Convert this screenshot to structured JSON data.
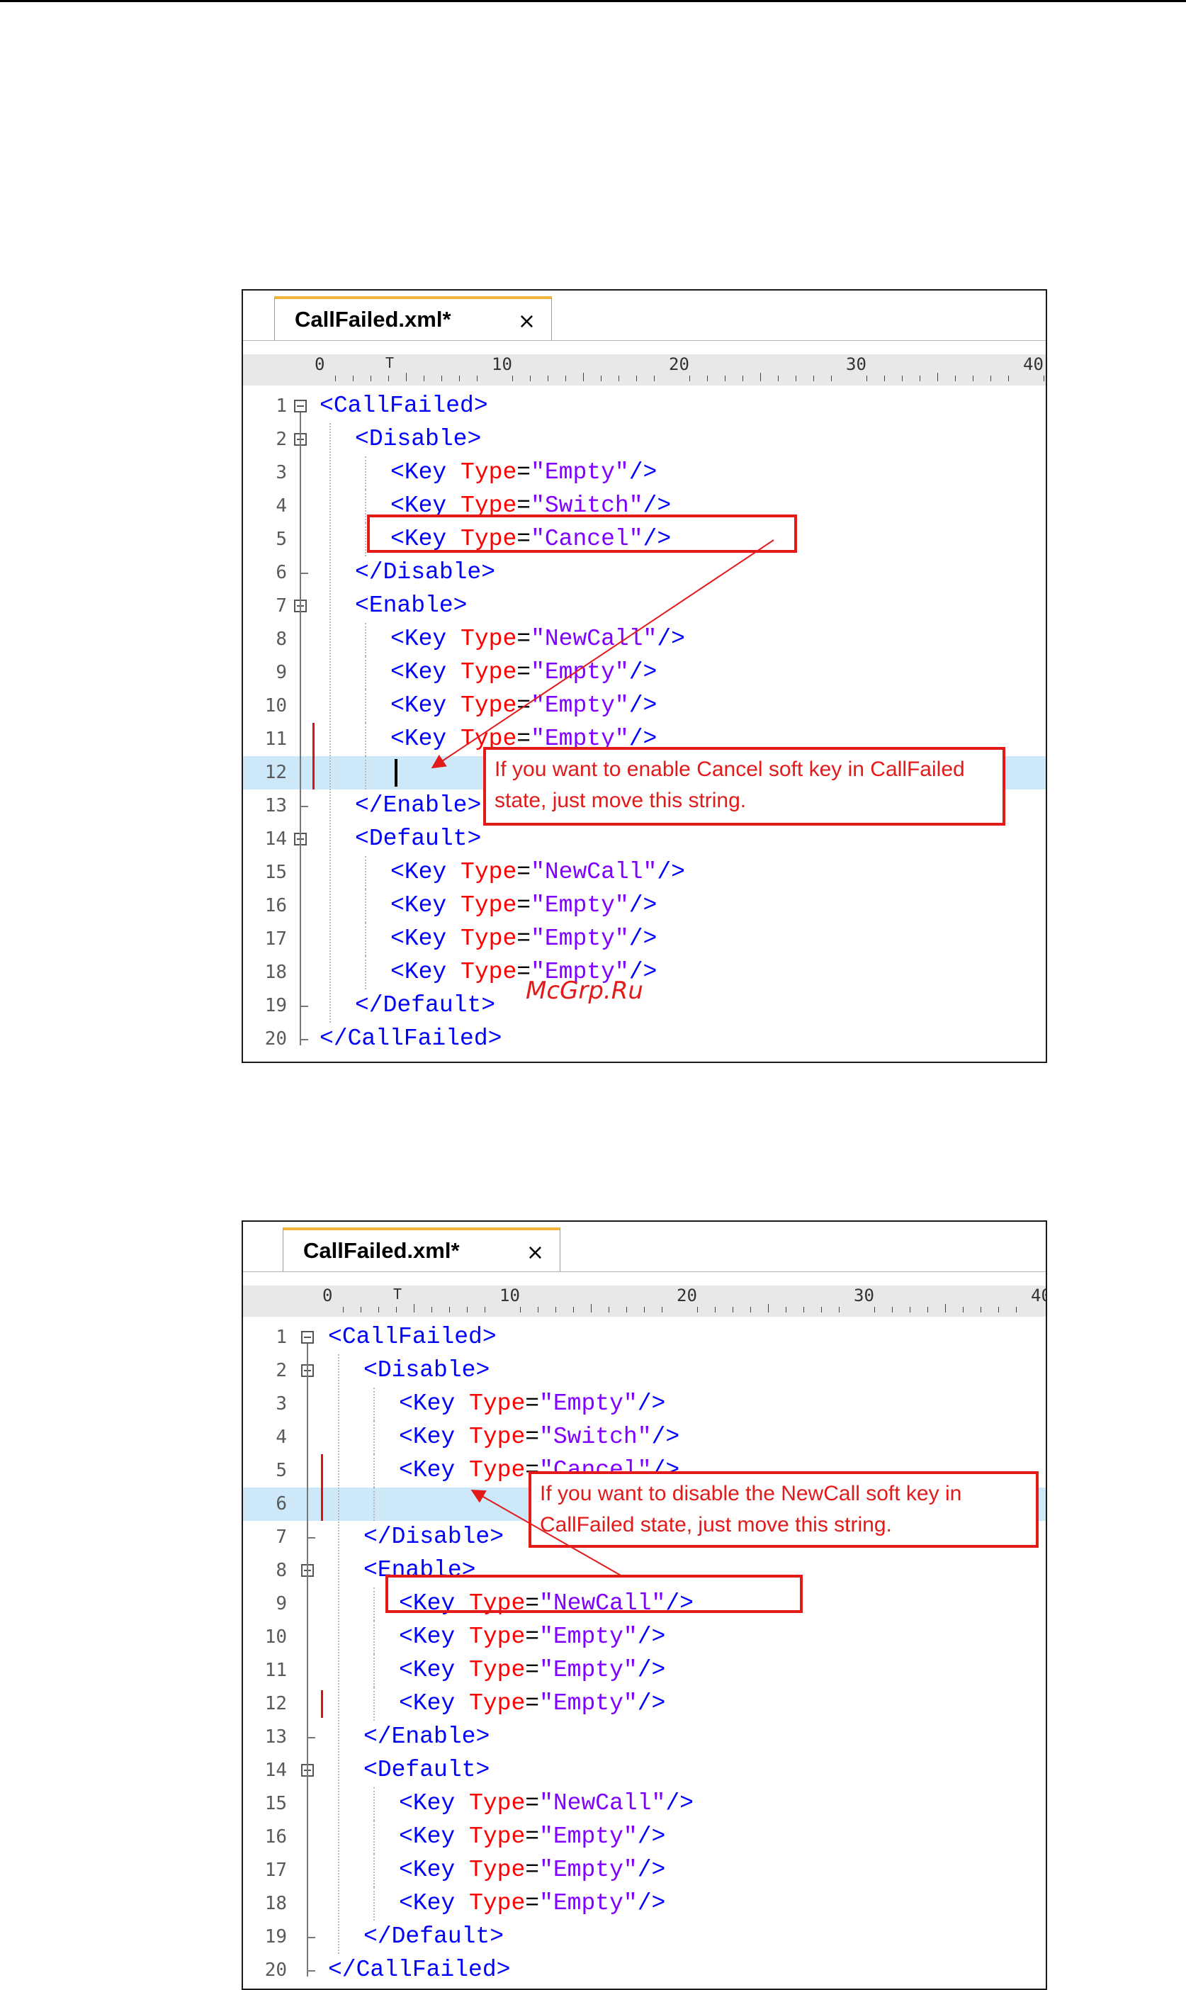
{
  "watermark": "McGrp.Ru",
  "colors": {
    "annotation": "#e21a1a",
    "tag": "#0000ff",
    "attribute": "#ff0000",
    "value": "#8000ff",
    "current_line": "#cde8f8",
    "tab_accent": "#f0b43c"
  },
  "ruler": {
    "labels": [
      "0",
      "10",
      "20",
      "30",
      "40"
    ],
    "marker": "T"
  },
  "editors": [
    {
      "tab": {
        "title": "CallFailed.xml*",
        "close": "×"
      },
      "current_line": 12,
      "callout": "If you want to enable Cancel soft key in CallFailed state, just move this string.",
      "lines": [
        {
          "n": "1",
          "indent": 0,
          "text": "<CallFailed>"
        },
        {
          "n": "2",
          "indent": 1,
          "text": "<Disable>"
        },
        {
          "n": "3",
          "indent": 2,
          "text": "<Key Type=\"Empty\"/>"
        },
        {
          "n": "4",
          "indent": 2,
          "text": "<Key Type=\"Switch\"/>"
        },
        {
          "n": "5",
          "indent": 2,
          "text": "<Key Type=\"Cancel\"/>"
        },
        {
          "n": "6",
          "indent": 1,
          "text": "</Disable>"
        },
        {
          "n": "7",
          "indent": 1,
          "text": "<Enable>"
        },
        {
          "n": "8",
          "indent": 2,
          "text": "<Key Type=\"NewCall\"/>"
        },
        {
          "n": "9",
          "indent": 2,
          "text": "<Key Type=\"Empty\"/>"
        },
        {
          "n": "10",
          "indent": 2,
          "text": "<Key Type=\"Empty\"/>"
        },
        {
          "n": "11",
          "indent": 2,
          "text": "<Key Type=\"Empty\"/>"
        },
        {
          "n": "12",
          "indent": 2,
          "text": ""
        },
        {
          "n": "13",
          "indent": 1,
          "text": "</Enable>"
        },
        {
          "n": "14",
          "indent": 1,
          "text": "<Default>"
        },
        {
          "n": "15",
          "indent": 2,
          "text": "<Key Type=\"NewCall\"/>"
        },
        {
          "n": "16",
          "indent": 2,
          "text": "<Key Type=\"Empty\"/>"
        },
        {
          "n": "17",
          "indent": 2,
          "text": "<Key Type=\"Empty\"/>"
        },
        {
          "n": "18",
          "indent": 2,
          "text": "<Key Type=\"Empty\"/>"
        },
        {
          "n": "19",
          "indent": 1,
          "text": "</Default>"
        },
        {
          "n": "20",
          "indent": 0,
          "text": "</CallFailed>"
        }
      ]
    },
    {
      "tab": {
        "title": "CallFailed.xml*",
        "close": "×"
      },
      "current_line": 6,
      "callout": "If you want to disable the NewCall soft key in CallFailed state, just move this string.",
      "lines": [
        {
          "n": "1",
          "indent": 0,
          "text": "<CallFailed>"
        },
        {
          "n": "2",
          "indent": 1,
          "text": "<Disable>"
        },
        {
          "n": "3",
          "indent": 2,
          "text": "<Key Type=\"Empty\"/>"
        },
        {
          "n": "4",
          "indent": 2,
          "text": "<Key Type=\"Switch\"/>"
        },
        {
          "n": "5",
          "indent": 2,
          "text": "<Key Type=\"Cancel\"/>"
        },
        {
          "n": "6",
          "indent": 2,
          "text": ""
        },
        {
          "n": "7",
          "indent": 1,
          "text": "</Disable>"
        },
        {
          "n": "8",
          "indent": 1,
          "text": "<Enable>"
        },
        {
          "n": "9",
          "indent": 2,
          "text": "<Key Type=\"NewCall\"/>"
        },
        {
          "n": "10",
          "indent": 2,
          "text": "<Key Type=\"Empty\"/>"
        },
        {
          "n": "11",
          "indent": 2,
          "text": "<Key Type=\"Empty\"/>"
        },
        {
          "n": "12",
          "indent": 2,
          "text": "<Key Type=\"Empty\"/>"
        },
        {
          "n": "13",
          "indent": 1,
          "text": "</Enable>"
        },
        {
          "n": "14",
          "indent": 1,
          "text": "<Default>"
        },
        {
          "n": "15",
          "indent": 2,
          "text": "<Key Type=\"NewCall\"/>"
        },
        {
          "n": "16",
          "indent": 2,
          "text": "<Key Type=\"Empty\"/>"
        },
        {
          "n": "17",
          "indent": 2,
          "text": "<Key Type=\"Empty\"/>"
        },
        {
          "n": "18",
          "indent": 2,
          "text": "<Key Type=\"Empty\"/>"
        },
        {
          "n": "19",
          "indent": 1,
          "text": "</Default>"
        },
        {
          "n": "20",
          "indent": 0,
          "text": "</CallFailed>"
        }
      ]
    }
  ]
}
